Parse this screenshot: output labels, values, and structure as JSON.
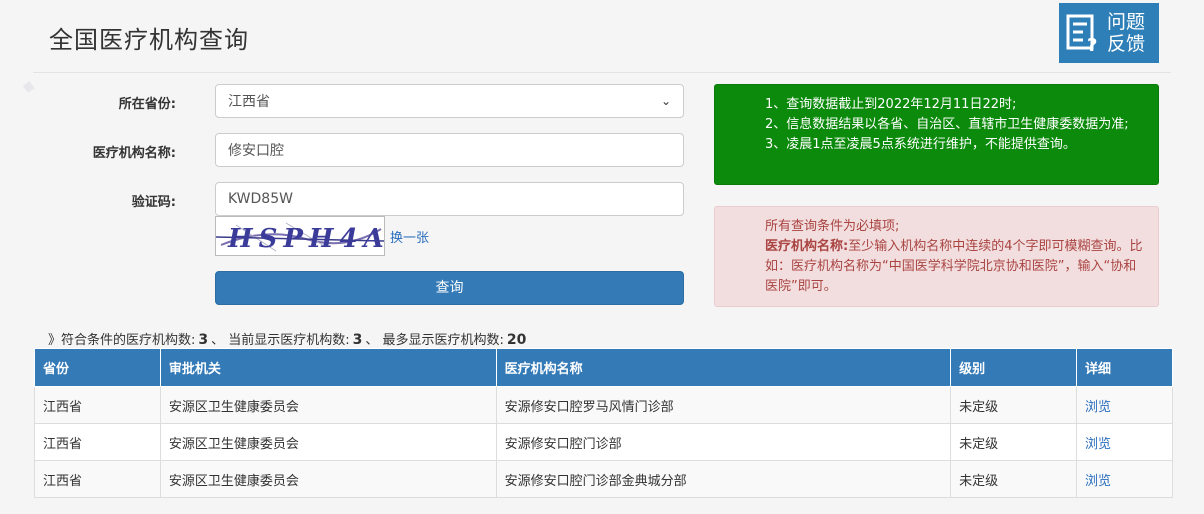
{
  "header": {
    "title": "全国医疗机构查询",
    "feedback_label": "问题反馈"
  },
  "form": {
    "province_label": "所在省份:",
    "province_value": "江西省",
    "name_label": "医疗机构名称:",
    "name_value": "修安口腔",
    "captcha_label": "验证码:",
    "captcha_value": "KWD85W",
    "captcha_image_text": "HSPH4A",
    "refresh_label": "换一张",
    "submit_label": "查询"
  },
  "notices": {
    "green": [
      "1、查询数据截止到2022年12月11日22时;",
      "2、信息数据结果以各省、自治区、直辖市卫生健康委数据为准;",
      "3、凌晨1点至凌晨5点系统进行维护，不能提供查询。"
    ],
    "red": {
      "line1": "所有查询条件为必填项;",
      "bold": "医疗机构名称:",
      "line2": "至少输入机构名称中连续的4个字即可模糊查询。比如：医疗机构名称为“中国医学科学院北京协和医院”，输入“协和医院”即可。"
    }
  },
  "summary": {
    "prefix": "》符合条件的医疗机构数:",
    "matched": "3",
    "sep1": "、 当前显示医疗机构数:",
    "shown": "3",
    "sep2": "、 最多显示医疗机构数:",
    "max": "20"
  },
  "table": {
    "headers": [
      "省份",
      "审批机关",
      "医疗机构名称",
      "级别",
      "详细"
    ],
    "rows": [
      [
        "江西省",
        "安源区卫生健康委员会",
        "安源修安口腔罗马风情门诊部",
        "未定级",
        "浏览"
      ],
      [
        "江西省",
        "安源区卫生健康委员会",
        "安源修安口腔门诊部",
        "未定级",
        "浏览"
      ],
      [
        "江西省",
        "安源区卫生健康委员会",
        "安源修安口腔门诊部金典城分部",
        "未定级",
        "浏览"
      ]
    ]
  },
  "colors": {
    "primary": "#337ab7",
    "notice_green": "#0b8a0b",
    "notice_red_bg": "#f2dede",
    "notice_red_text": "#a94442",
    "link": "#2a6ebd"
  }
}
